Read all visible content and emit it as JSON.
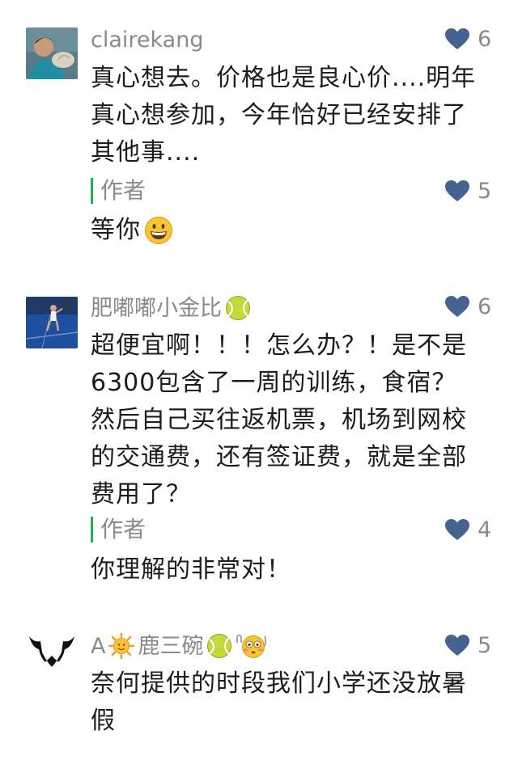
{
  "comments": [
    {
      "nickname": "clairekang",
      "likes": "6",
      "text": "真心想去。价格也是良心价....明年真心想参加，今年恰好已经安排了其他事....",
      "reply": {
        "label": "作者",
        "likes": "5",
        "text": "等你"
      }
    },
    {
      "nickname": "肥嘟嘟小金比",
      "likes": "6",
      "text": "超便宜啊！！！怎么办？！是不是6300包含了一周的训练，食宿？然后自己买往返机票，机场到网校的交通费，还有签证费，就是全部费用了？",
      "reply": {
        "label": "作者",
        "likes": "4",
        "text": "你理解的非常对！"
      }
    },
    {
      "nickname_prefix": "A",
      "nickname_main": "鹿三碗",
      "likes": "5",
      "text": "奈何提供的时段我们小学还没放暑假"
    }
  ],
  "icons": {
    "like": "heart-icon",
    "smile": "grinning-face-emoji",
    "tennis": "tennis-ball-emoji",
    "sun": "sun-face-emoji",
    "flushed": "flushed-face-emoji"
  },
  "colors": {
    "heart": "#46628e",
    "reply_bar": "#22b14c",
    "meta_gray": "#8a8a8a"
  }
}
